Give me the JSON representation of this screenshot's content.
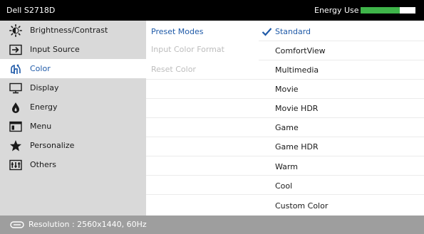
{
  "header": {
    "model": "Dell S2718D",
    "energy_label": "Energy Use",
    "energy_level": 0.72,
    "energy_fill_color": "#3fb54a"
  },
  "menu": {
    "items": [
      {
        "label": "Brightness/Contrast",
        "icon": "brightness-icon"
      },
      {
        "label": "Input Source",
        "icon": "input-source-icon"
      },
      {
        "label": "Color",
        "icon": "color-icon",
        "selected": true
      },
      {
        "label": "Display",
        "icon": "display-icon"
      },
      {
        "label": "Energy",
        "icon": "energy-icon"
      },
      {
        "label": "Menu",
        "icon": "menu-icon"
      },
      {
        "label": "Personalize",
        "icon": "star-icon"
      },
      {
        "label": "Others",
        "icon": "others-icon"
      }
    ]
  },
  "submenu": {
    "items": [
      {
        "label": "Preset Modes",
        "state": "active"
      },
      {
        "label": "Input Color Format",
        "state": "disabled"
      },
      {
        "label": "Reset Color",
        "state": "disabled"
      }
    ]
  },
  "options": {
    "items": [
      {
        "label": "Standard",
        "selected": true
      },
      {
        "label": "ComfortView"
      },
      {
        "label": "Multimedia"
      },
      {
        "label": "Movie"
      },
      {
        "label": "Movie HDR"
      },
      {
        "label": "Game"
      },
      {
        "label": "Game HDR"
      },
      {
        "label": "Warm"
      },
      {
        "label": "Cool"
      },
      {
        "label": "Custom Color"
      }
    ]
  },
  "footer": {
    "resolution": "Resolution : 2560x1440, 60Hz"
  },
  "colors": {
    "accent": "#1f5aa8",
    "header_bg": "#000000",
    "menu_bg": "#d9d9d9",
    "footer_bg": "#9e9e9e"
  }
}
